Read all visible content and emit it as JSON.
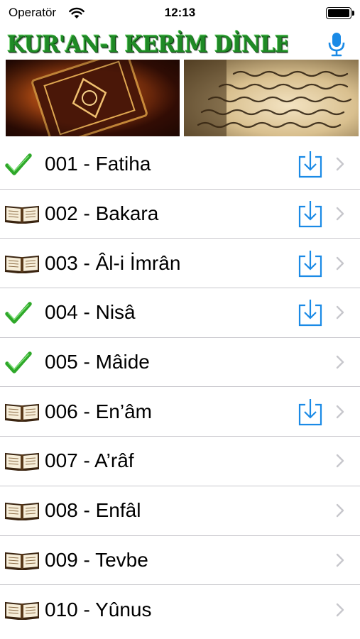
{
  "status_bar": {
    "carrier": "Operatör",
    "time": "12:13",
    "wifi_icon": "wifi-icon",
    "battery_icon": "battery-icon"
  },
  "header": {
    "title": "KUR'AN-I KERİM DİNLE",
    "mic_icon": "microphone-icon",
    "title_color": "#1f8a26",
    "accent_color": "#1a8ae6"
  },
  "banner": {
    "left_image": "quran-cover-image",
    "right_image": "quran-pages-image"
  },
  "surahs": [
    {
      "label": "001 - Fatiha",
      "status": "downloaded",
      "download_available": true
    },
    {
      "label": "002 - Bakara",
      "status": "book",
      "download_available": true
    },
    {
      "label": "003 - Âl-i İmrân",
      "status": "book",
      "download_available": true
    },
    {
      "label": "004 - Nisâ",
      "status": "downloaded",
      "download_available": true
    },
    {
      "label": "005 - Mâide",
      "status": "downloaded",
      "download_available": false
    },
    {
      "label": "006 - En’âm",
      "status": "book",
      "download_available": true
    },
    {
      "label": "007 - A’râf",
      "status": "book",
      "download_available": false
    },
    {
      "label": "008 - Enfâl",
      "status": "book",
      "download_available": false
    },
    {
      "label": "009 - Tevbe",
      "status": "book",
      "download_available": false
    },
    {
      "label": "010 - Yûnus",
      "status": "book",
      "download_available": false
    }
  ]
}
